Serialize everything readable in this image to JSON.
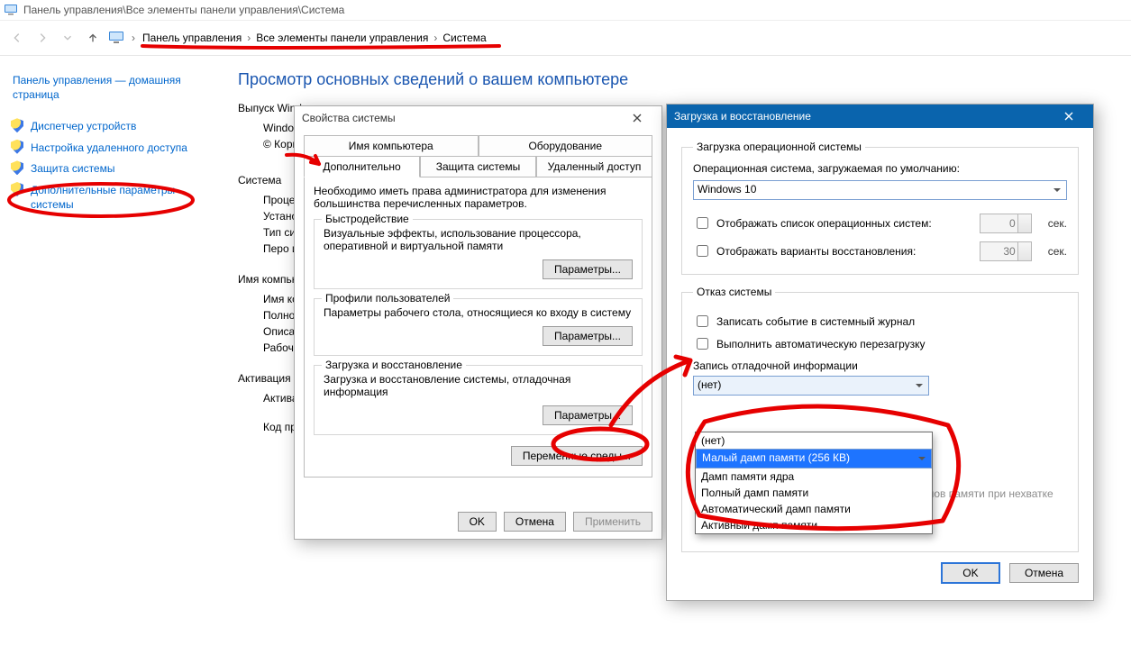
{
  "window": {
    "title": "Панель управления\\Все элементы панели управления\\Система"
  },
  "breadcrumb": [
    "Панель управления",
    "Все элементы панели управления",
    "Система"
  ],
  "sidebar": {
    "home": "Панель управления — домашняя страница",
    "links": [
      "Диспетчер устройств",
      "Настройка удаленного доступа",
      "Защита системы",
      "Дополнительные параметры системы"
    ]
  },
  "page": {
    "title": "Просмотр основных сведений о вашем компьютере",
    "edition_h": "Выпуск Windows",
    "edition_line1": "Windows 10",
    "edition_line2": "© Корпорац",
    "system_h": "Система",
    "rows": [
      "Процессор:",
      "Установленн (ОЗУ):",
      "Тип системы",
      "Перо и сенс"
    ],
    "name_h": "Имя компьютера",
    "name_rows": [
      "Имя компь",
      "Полное имя",
      "Описание:",
      "Рабочая гру"
    ],
    "activation_h": "Активация Windo",
    "activation_row": "Активация W",
    "prod": "Код продукт"
  },
  "dlg1": {
    "title": "Свойства системы",
    "tabs_top": [
      "Имя компьютера",
      "Оборудование"
    ],
    "tabs_bot": [
      "Дополнительно",
      "Защита системы",
      "Удаленный доступ"
    ],
    "note": "Необходимо иметь права администратора для изменения большинства перечисленных параметров.",
    "perf_h": "Быстродействие",
    "perf_txt": "Визуальные эффекты, использование процессора, оперативной и виртуальной памяти",
    "prof_h": "Профили пользователей",
    "prof_txt": "Параметры рабочего стола, относящиеся ко входу в систему",
    "boot_h": "Загрузка и восстановление",
    "boot_txt": "Загрузка и восстановление системы, отладочная информация",
    "params_btn": "Параметры...",
    "env_btn": "Переменные среды...",
    "ok": "OK",
    "cancel": "Отмена",
    "apply": "Применить"
  },
  "dlg2": {
    "title": "Загрузка и восстановление",
    "boot_h": "Загрузка операционной системы",
    "default_os_lbl": "Операционная система, загружаемая по умолчанию:",
    "default_os": "Windows 10",
    "show_list": "Отображать список операционных систем:",
    "show_list_sec": "0",
    "show_recov": "Отображать варианты восстановления:",
    "show_recov_sec": "30",
    "sec_unit": "сек.",
    "fail_h": "Отказ системы",
    "log_event": "Записать событие в системный журнал",
    "auto_reboot": "Выполнить автоматическую перезагрузку",
    "dbg_h": "Запись отладочной информации",
    "dbg_sel": "(нет)",
    "disable_autodel": "Отключить автоматическое удаление дампов памяти при нехватке места на диске",
    "ok": "OK",
    "cancel": "Отмена"
  },
  "dropdown": {
    "options": [
      "(нет)",
      "Малый дамп памяти (256 КВ)",
      "Дамп памяти ядра",
      "Полный дамп памяти",
      "Автоматический дамп памяти",
      "Активный дамп памяти"
    ],
    "highlighted_index": 1
  }
}
